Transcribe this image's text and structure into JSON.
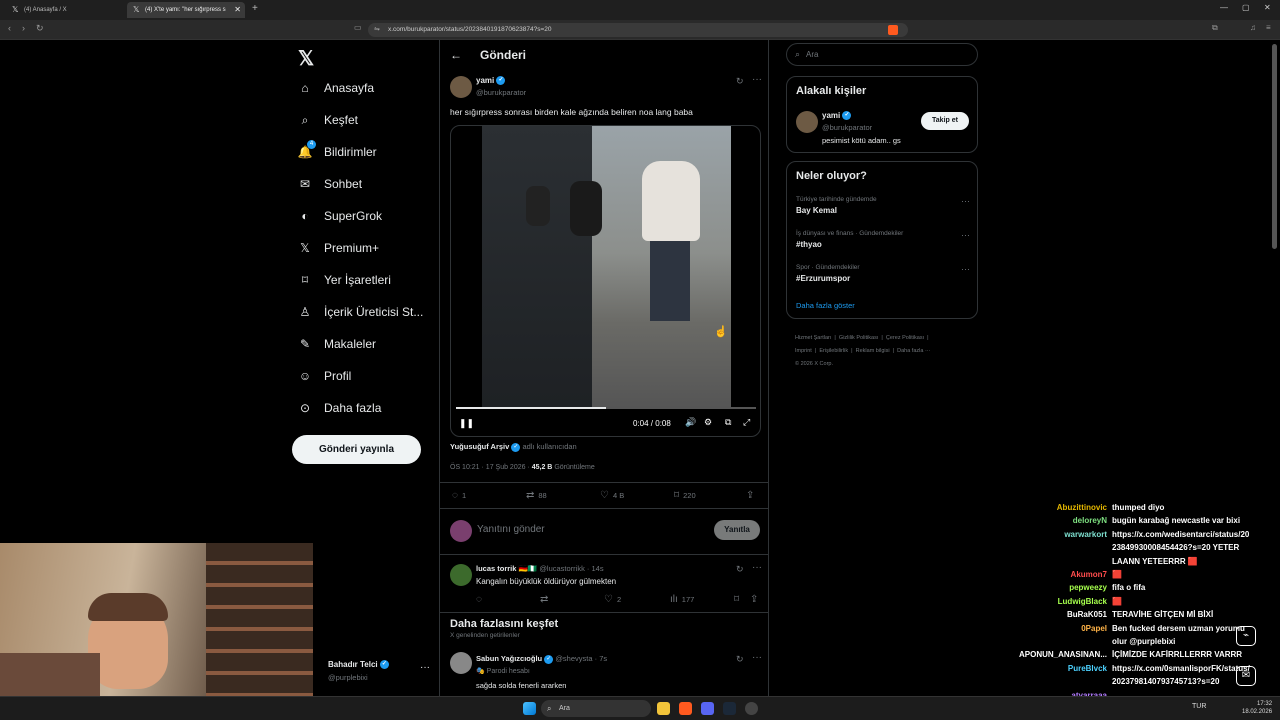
{
  "browser": {
    "tabs": [
      {
        "label": "(4) Anasayfa / X",
        "active": false
      },
      {
        "label": "(4) X'te yamı: \"her sığırpress s",
        "active": true
      }
    ],
    "url": "x.com/burukparator/status/2023840191870623874?s=20"
  },
  "nav": {
    "items": [
      {
        "label": "Anasayfa",
        "icon": "home-icon"
      },
      {
        "label": "Keşfet",
        "icon": "search-icon"
      },
      {
        "label": "Bildirimler",
        "icon": "bell-icon",
        "badge": "4"
      },
      {
        "label": "Sohbet",
        "icon": "mail-icon"
      },
      {
        "label": "SuperGrok",
        "icon": "grok-icon"
      },
      {
        "label": "Premium+",
        "icon": "x-logo-icon"
      },
      {
        "label": "Yer İşaretleri",
        "icon": "bookmark-icon"
      },
      {
        "label": "İçerik Üreticisi St...",
        "icon": "creator-icon"
      },
      {
        "label": "Makaleler",
        "icon": "article-icon"
      },
      {
        "label": "Profil",
        "icon": "person-icon"
      },
      {
        "label": "Daha fazla",
        "icon": "more-circle-icon"
      }
    ],
    "post_button": "Gönderi yayınla",
    "account": {
      "name": "Bahadır Telci",
      "handle": "@purplebixi"
    }
  },
  "post": {
    "header_title": "Gönderi",
    "author": "yami",
    "handle": "@burukparator",
    "text": "her sığırpress sonrası birden kale ağzında beliren noa lang baba",
    "video": {
      "time": "0:04 / 0:08",
      "progress": 0.5
    },
    "source_author": "Yuğusuğuf Arşiv",
    "source_suffix": "adlı kullanıcıdan",
    "timestamp": "ÖS 10:21 · 17 Şub 2026 ·",
    "views_count": "45,2 B",
    "views_label": "Görüntüleme",
    "stats": {
      "replies": "1",
      "reposts": "88",
      "likes": "4 B",
      "bookmarks": "220"
    },
    "reply_placeholder": "Yanıtını gönder",
    "reply_button": "Yanıtla"
  },
  "reply": {
    "author": "lucas torrik",
    "flags": "🇩🇪🇳🇬",
    "handle": "@lucastorrikk · 14s",
    "text": "Kangalın büyüklük öldürüyor gülmekten",
    "stats": {
      "likes": "2",
      "views": "177"
    }
  },
  "discover": {
    "title": "Daha fazlasını keşfet",
    "subtitle": "X genelinden getirilenler",
    "post": {
      "author": "Sabun Yağızcıoğlu",
      "handle": "@shevysta · 7s",
      "label": "Parodi hesabı",
      "text": "sağda solda fenerli ararken"
    }
  },
  "sidebar": {
    "search_placeholder": "Ara",
    "related_title": "Alakalı kişiler",
    "related": {
      "name": "yami",
      "handle": "@burukparator",
      "bio": "pesimist kötü adam.. gs",
      "follow": "Takip et"
    },
    "trends_title": "Neler oluyor?",
    "trends": [
      {
        "category": "Türkiye tarihinde gündemde",
        "name": "Bay Kemal"
      },
      {
        "category": "İş dünyası ve finans · Gündemdekiler",
        "name": "#thyao"
      },
      {
        "category": "Spor · Gündemdekiler",
        "name": "#Erzurumspor"
      }
    ],
    "show_more": "Daha fazla göster",
    "footer_line1": [
      "Hizmet Şartları",
      "Gizlilik Politikası",
      "Çerez Politikası"
    ],
    "footer_line2": [
      "Imprint",
      "Erişilebilirlik",
      "Reklam bilgisi",
      "Daha fazla ···"
    ],
    "copyright": "© 2026 X Corp."
  },
  "chat": [
    {
      "user": "Abuzittinovic",
      "color": "#e6b800",
      "msg": "thumped diyo"
    },
    {
      "user": "deloreyN",
      "color": "#7ee081",
      "msg": "bugün karabağ newcastle var bixi"
    },
    {
      "user": "warwarkort",
      "color": "#7ee0d0",
      "msg": "https://x.com/wedisentarci/status/20"
    },
    {
      "user": "",
      "color": "#fff",
      "msg": "23849930008454426?s=20 YETER"
    },
    {
      "user": "",
      "color": "#fff",
      "msg": "LAANN YETEERRR 🟥"
    },
    {
      "user": "Akumon7",
      "color": "#ff4d4d",
      "msg": "🟥"
    },
    {
      "user": "pepweezy",
      "color": "#a6ff4d",
      "msg": "fifa o fifa"
    },
    {
      "user": "LudwigBlack",
      "color": "#a6ff4d",
      "msg": "🟥"
    },
    {
      "user": "BuRaK051",
      "color": "#ffffff",
      "msg": "TERAVİHE GİTÇEN Mİ BİXİ"
    },
    {
      "user": "0Papel",
      "color": "#ffb347",
      "msg": "Ben fucked dersem uzman yorumu"
    },
    {
      "user": "",
      "color": "#fff",
      "msg": "olur @purplebixi"
    },
    {
      "user": "APONUN_ANASINAN...",
      "color": "#ffffff",
      "msg": "İÇİMİZDE KAFİRRLLERRR VARRR"
    },
    {
      "user": "PureBlvck",
      "color": "#4dd2ff",
      "msg": "https://x.com/0smanlisporFK/status/"
    },
    {
      "user": "",
      "color": "#fff",
      "msg": "2023798140793745713?s=20"
    },
    {
      "user": "atyarraaa",
      "color": "#b27bff",
      "msg": ""
    }
  ],
  "taskbar": {
    "search": "Ara",
    "lang": "TUR",
    "time": "17:32",
    "date": "18.02.2026"
  }
}
